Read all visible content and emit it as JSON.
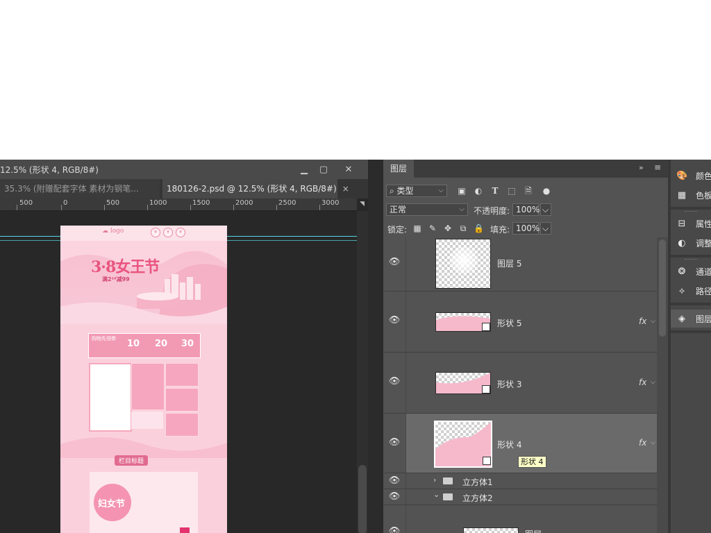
{
  "window": {
    "title": "12.5% (形状 4, RGB/8#)",
    "minimize": "▁",
    "maximize": "▢",
    "close": "✕"
  },
  "tabs": [
    {
      "label": "35.3% (附赠配套字体  素材为钢笔...",
      "close": "",
      "active": false
    },
    {
      "label": "180126-2.psd @ 12.5% (形状 4, RGB/8#)",
      "close": "×",
      "active": true
    }
  ],
  "ruler": {
    "labels": [
      "500",
      "0",
      "500",
      "1000",
      "1500",
      "2000",
      "2500",
      "3000"
    ],
    "menu": "◥"
  },
  "artboard": {
    "logo": "☁ logo",
    "circle_labels": [
      "¥",
      "¥",
      "¥"
    ],
    "title": "3·8女王节",
    "promo": "满2¹⁸减99",
    "coupon_title": "购物先领券",
    "coupon_values": [
      "10",
      "20",
      "30"
    ],
    "section_title": "栏目标题",
    "bubble_text": "妇女节"
  },
  "layers_panel": {
    "tab": "图层",
    "collapse": "»",
    "menu": "≡",
    "filter_kind": "类型",
    "filter_icons": [
      "image-filter-icon",
      "adjust-filter-icon",
      "text-filter-icon",
      "shape-filter-icon",
      "smart-filter-icon",
      "toggle-filter-icon"
    ],
    "blend_mode": "正常",
    "opacity_label": "不透明度:",
    "opacity_value": "100%",
    "lock_label": "锁定:",
    "fill_label": "填充:",
    "fill_value": "100%",
    "layers": [
      {
        "name": "图层 5",
        "fx": false,
        "active": false,
        "kind": "pixel"
      },
      {
        "name": "形状 5",
        "fx": true,
        "active": false,
        "kind": "shape"
      },
      {
        "name": "形状 3",
        "fx": true,
        "active": false,
        "kind": "shape"
      },
      {
        "name": "形状 4",
        "fx": true,
        "active": true,
        "kind": "shape"
      }
    ],
    "groups": [
      {
        "name": "立方体1",
        "expanded": false
      },
      {
        "name": "立方体2",
        "expanded": true
      }
    ],
    "partial_layer_name": "图层",
    "tooltip": "形状 4",
    "fx_label": "fx"
  },
  "dock": {
    "items": [
      {
        "label": "颜色",
        "icon": "palette-icon"
      },
      {
        "label": "色板",
        "icon": "swatches-icon"
      },
      {
        "label": "属性",
        "icon": "properties-icon"
      },
      {
        "label": "调整",
        "icon": "adjustments-icon"
      },
      {
        "label": "通道",
        "icon": "channels-icon"
      },
      {
        "label": "路径",
        "icon": "paths-icon"
      },
      {
        "label": "图层",
        "icon": "layers-icon"
      }
    ]
  }
}
